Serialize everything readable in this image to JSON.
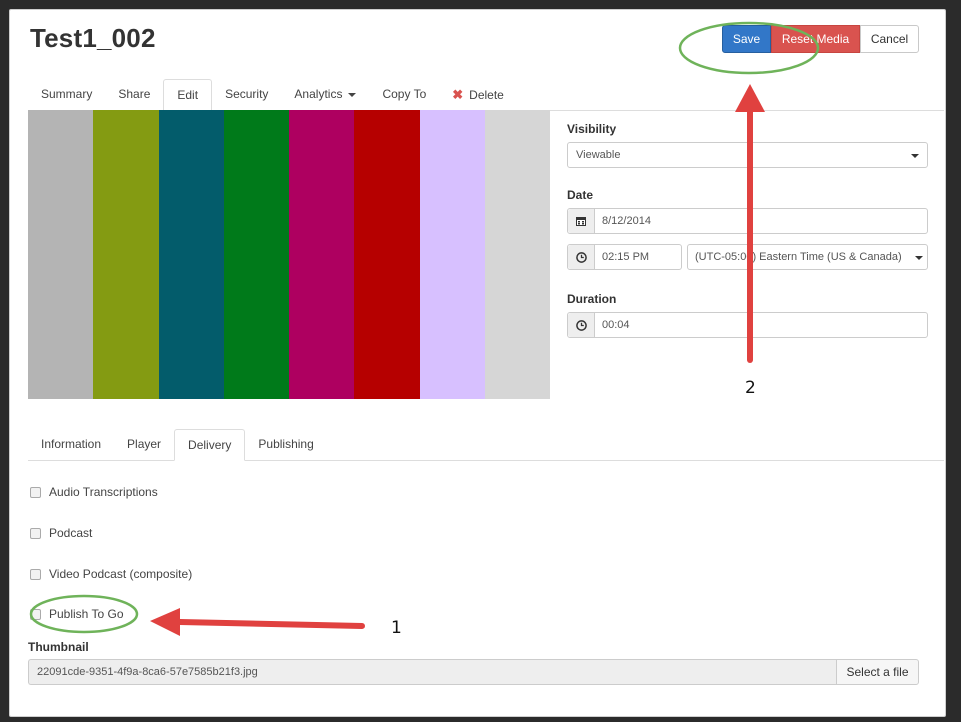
{
  "page": {
    "title": "Test1_002"
  },
  "header_buttons": {
    "save": "Save",
    "reset_media": "Reset Media",
    "cancel": "Cancel"
  },
  "tabs": [
    {
      "label": "Summary"
    },
    {
      "label": "Share"
    },
    {
      "label": "Edit"
    },
    {
      "label": "Security"
    },
    {
      "label": "Analytics"
    },
    {
      "label": "Copy To"
    },
    {
      "label": "Delete"
    }
  ],
  "active_tab": "Edit",
  "color_bars": [
    "#b4b4b4",
    "#849b12",
    "#035c6b",
    "#007a1a",
    "#ae0060",
    "#b60000",
    "#d7c0ff",
    "#d6d6d6"
  ],
  "visibility": {
    "label": "Visibility",
    "value": "Viewable"
  },
  "date": {
    "label": "Date",
    "date_value": "8/12/2014",
    "time_value": "02:15 PM",
    "timezone_value": "(UTC-05:00) Eastern Time (US & Canada)"
  },
  "duration": {
    "label": "Duration",
    "value": "00:04"
  },
  "subtabs": [
    {
      "label": "Information"
    },
    {
      "label": "Player"
    },
    {
      "label": "Delivery"
    },
    {
      "label": "Publishing"
    }
  ],
  "active_subtab": "Delivery",
  "checkboxes": [
    {
      "label": "Audio Transcriptions",
      "checked": false
    },
    {
      "label": "Podcast",
      "checked": false
    },
    {
      "label": "Video Podcast (composite)",
      "checked": false
    },
    {
      "label": "Publish To Go",
      "checked": false
    }
  ],
  "thumbnail": {
    "label": "Thumbnail",
    "filename": "22091cde-9351-4f9a-8ca6-57e7585b21f3.jpg",
    "select_label": "Select a file"
  },
  "annotations": {
    "number_1": "1",
    "number_2": "2"
  },
  "colors": {
    "primary": "#3277c8",
    "danger": "#d9534f",
    "annotation_arrow": "#e0413f",
    "annotation_circle": "#6fb35a"
  },
  "icons": {
    "calendar": "calendar-icon",
    "clock": "clock-icon",
    "delete": "delete-x-icon"
  }
}
